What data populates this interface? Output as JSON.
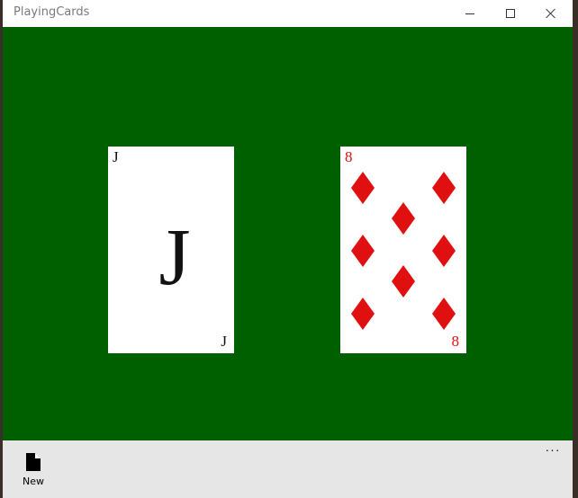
{
  "window": {
    "title": "PlayingCards"
  },
  "colors": {
    "table_felt": "#006000",
    "card_face": "#ffffff",
    "red_suit": "#e01010",
    "black_suit": "#111111",
    "app_bar": "#e6e6e6"
  },
  "cards": [
    {
      "rank": "J",
      "suit": "none",
      "color": "black",
      "center_glyph": "J"
    },
    {
      "rank": "8",
      "suit": "diamonds",
      "color": "red",
      "pip_count": 8
    }
  ],
  "appbar": {
    "new_label": "New",
    "new_icon": "document-icon",
    "more_glyph": "···",
    "more_icon": "more-icon"
  }
}
